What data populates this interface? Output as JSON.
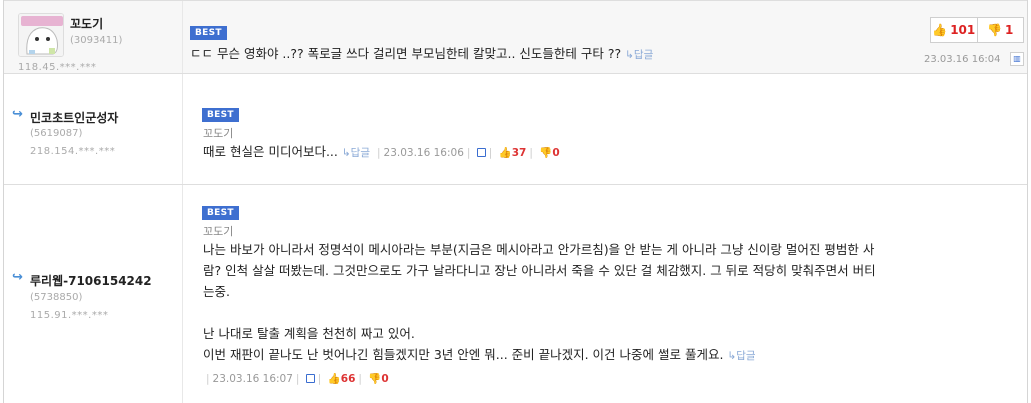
{
  "comments": [
    {
      "nickname": "꼬도기",
      "user_id": "(3093411)",
      "ip": "118.45.***.***",
      "badge": "BEST",
      "text": "ㄷㄷ 무슨 영화야 ..?? 폭로글 쓰다 걸리면  부모님한테 칼맞고.. 신도들한테 구타 ??",
      "reply_label": "↳답글",
      "upvotes": "101",
      "downvotes": "1",
      "date": "23.03.16 16:04",
      "icons": {
        "upvote": "thumbs-up-icon",
        "downvote": "thumbs-down-icon",
        "report": "report-icon"
      }
    },
    {
      "nickname": "민코초트인군성자",
      "user_id": "(5619087)",
      "ip": "218.154.***.***",
      "badge": "BEST",
      "author": "꼬도기",
      "text": "때로 현실은 미디어보다...",
      "reply_label": "↳답글",
      "date": "23.03.16 16:06",
      "upvotes": "37",
      "downvotes": "0"
    },
    {
      "nickname": "루리웹-7106154242",
      "user_id": "(5738850)",
      "ip": "115.91.***.***",
      "badge": "BEST",
      "author": "꼬도기",
      "lines": [
        "나는 바보가 아니라서 정명석이 메시아라는 부분(지금은 메시아라고 안가르침)을 안 받는 게 아니라 그냥 신이랑 멀어진 평범한 사",
        "람? 인척 살살 떠봤는데. 그것만으로도 가구 날라다니고 장난 아니라서 죽을 수 있단 걸 체감했지. 그 뒤로 적당히 맞춰주면서 버티",
        "는중.",
        "난 나대로 탈출 계획을 천천히 짜고 있어.",
        "이번 재판이 끝나도 난 벗어나긴 힘들겠지만 3년 안엔 뭐... 준비 끝나겠지. 이건 나중에 썰로 풀게요."
      ],
      "reply_label": "↳답글",
      "date": "23.03.16 16:07",
      "upvotes": "66",
      "downvotes": "0"
    }
  ],
  "colors": {
    "accent": "#3e6fd0",
    "vote_count": "#dd2222",
    "reply_link": "#8aa9d6"
  }
}
